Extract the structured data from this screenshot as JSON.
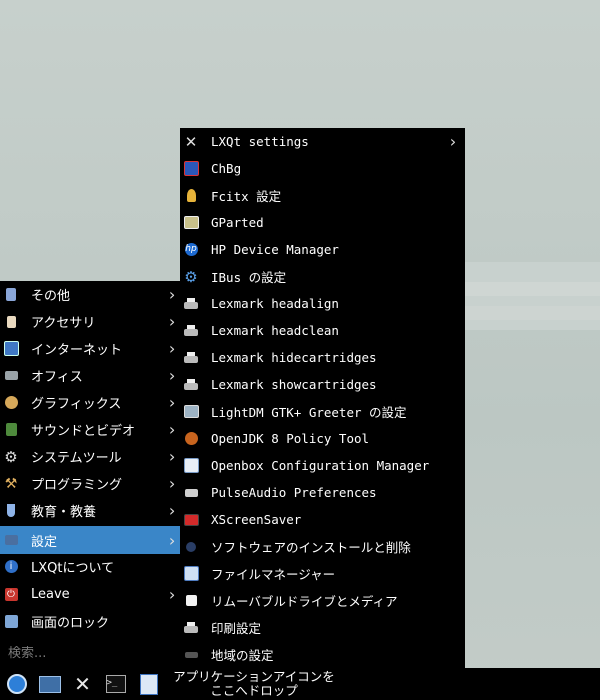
{
  "main_menu": {
    "items": [
      {
        "label": "その他",
        "icon": "other-icon",
        "submenu": true
      },
      {
        "label": "アクセサリ",
        "icon": "accessories-icon",
        "submenu": true
      },
      {
        "label": "インターネット",
        "icon": "internet-icon",
        "submenu": true
      },
      {
        "label": "オフィス",
        "icon": "office-icon",
        "submenu": true
      },
      {
        "label": "グラフィックス",
        "icon": "graphics-icon",
        "submenu": true
      },
      {
        "label": "サウンドとビデオ",
        "icon": "sound-video-icon",
        "submenu": true
      },
      {
        "label": "システムツール",
        "icon": "system-tools-icon",
        "submenu": true
      },
      {
        "label": "プログラミング",
        "icon": "programming-icon",
        "submenu": true
      },
      {
        "label": "教育・教養",
        "icon": "education-icon",
        "submenu": true
      },
      {
        "label": "設定",
        "icon": "settings-icon",
        "submenu": true,
        "selected": true
      },
      {
        "label": "LXQtについて",
        "icon": "info-icon",
        "submenu": false
      },
      {
        "label": "Leave",
        "icon": "leave-icon",
        "submenu": true
      },
      {
        "label": "画面のロック",
        "icon": "lock-screen-icon",
        "submenu": false
      }
    ],
    "search_placeholder": "検索...",
    "arrow": "›"
  },
  "sub_menu": {
    "items": [
      {
        "label": "LXQt settings",
        "icon": "tools-icon",
        "submenu": true
      },
      {
        "label": "ChBg",
        "icon": "chbg-icon",
        "submenu": false
      },
      {
        "label": "Fcitx 設定",
        "icon": "fcitx-icon",
        "submenu": false
      },
      {
        "label": "GParted",
        "icon": "gparted-icon",
        "submenu": false
      },
      {
        "label": "HP Device Manager",
        "icon": "hp-icon",
        "submenu": false
      },
      {
        "label": "IBus の設定",
        "icon": "gear-icon",
        "submenu": false
      },
      {
        "label": "Lexmark headalign",
        "icon": "printer-icon",
        "submenu": false
      },
      {
        "label": "Lexmark headclean",
        "icon": "printer-icon",
        "submenu": false
      },
      {
        "label": "Lexmark hidecartridges",
        "icon": "printer-icon",
        "submenu": false
      },
      {
        "label": "Lexmark showcartridges",
        "icon": "printer-icon",
        "submenu": false
      },
      {
        "label": "LightDM GTK+ Greeter の設定",
        "icon": "lightdm-icon",
        "submenu": false
      },
      {
        "label": "OpenJDK 8 Policy Tool",
        "icon": "java-icon",
        "submenu": false
      },
      {
        "label": "Openbox Configuration Manager",
        "icon": "openbox-icon",
        "submenu": false
      },
      {
        "label": "PulseAudio Preferences",
        "icon": "pulseaudio-icon",
        "submenu": false
      },
      {
        "label": "XScreenSaver",
        "icon": "xscreensaver-icon",
        "submenu": false
      },
      {
        "label": "ソフトウェアのインストールと削除",
        "icon": "software-icon",
        "submenu": false
      },
      {
        "label": "ファイルマネージャー",
        "icon": "file-manager-icon",
        "submenu": false
      },
      {
        "label": "リムーバブルドライブとメディア",
        "icon": "removable-media-icon",
        "submenu": false
      },
      {
        "label": "印刷設定",
        "icon": "printer-icon",
        "submenu": false
      },
      {
        "label": "地域の設定",
        "icon": "region-icon",
        "submenu": false
      }
    ],
    "arrow": "›"
  },
  "taskbar": {
    "buttons": [
      "start-menu-icon",
      "show-desktop-icon",
      "settings-tools-icon",
      "terminal-icon",
      "file-manager-icon"
    ],
    "drop_hint": "アプリケーションアイコンを\nここへドロップ"
  },
  "colors": {
    "selection": "#3a86c8",
    "menu_bg": "#000000"
  }
}
